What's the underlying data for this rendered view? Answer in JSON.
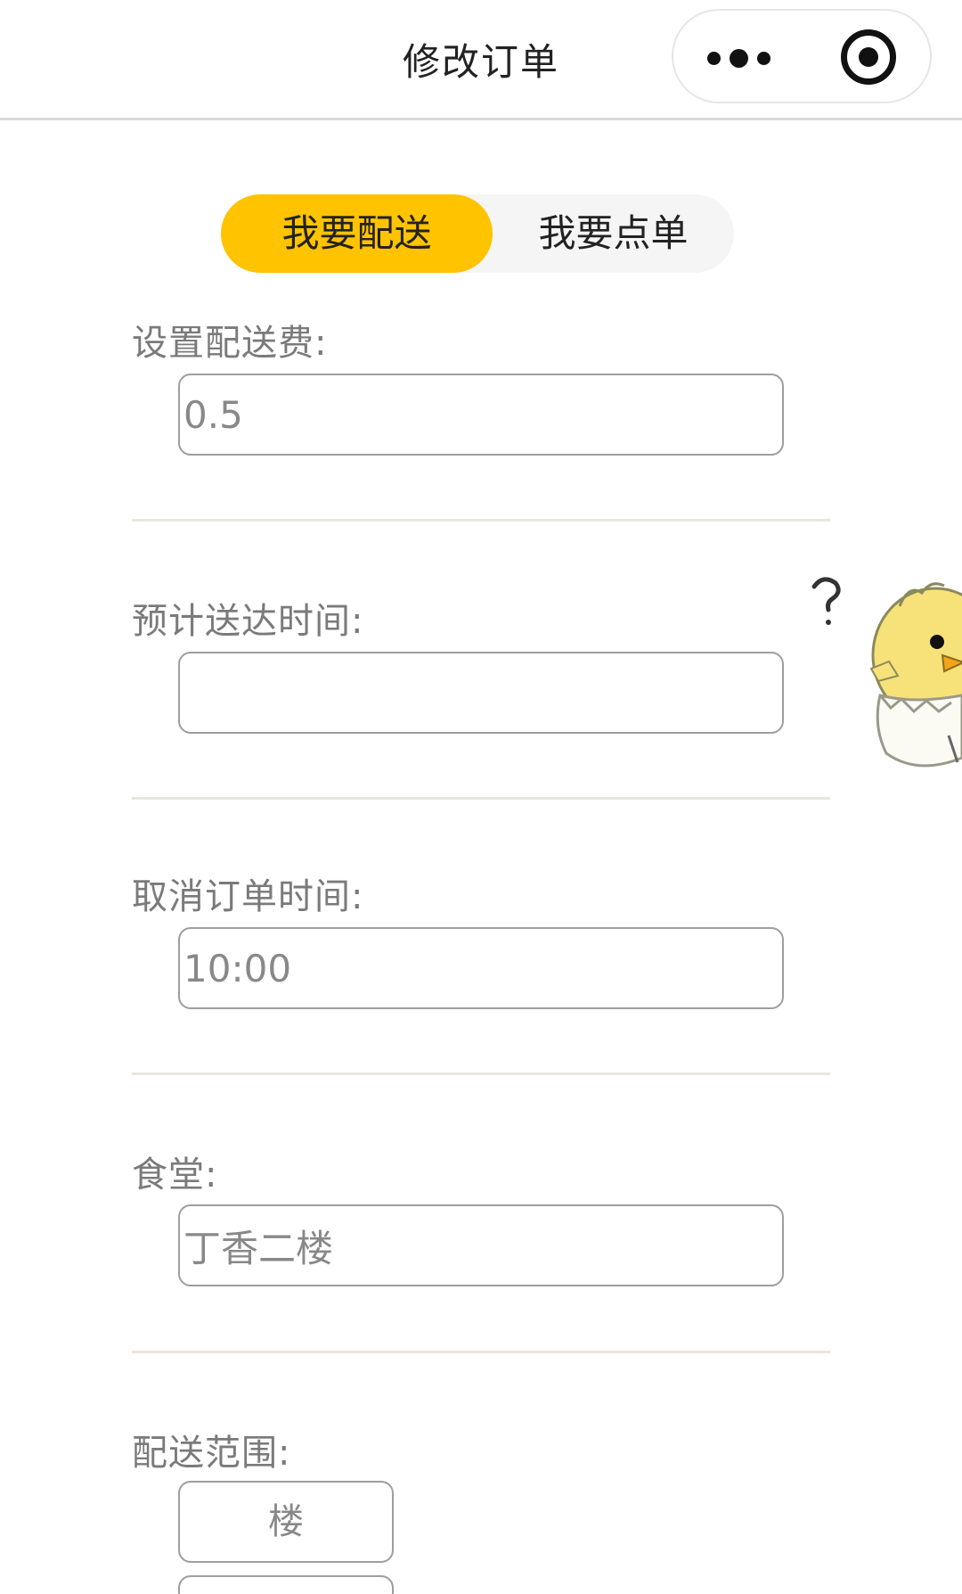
{
  "navbar": {
    "title": "修改订单",
    "capsule": {
      "more_icon": "more-dots-icon",
      "close_icon": "target-circle-icon"
    }
  },
  "tabs": [
    {
      "label": "我要配送",
      "active": true
    },
    {
      "label": "我要点单",
      "active": false
    }
  ],
  "form": {
    "delivery_fee": {
      "label": "设置配送费:",
      "value": "0.5"
    },
    "eta": {
      "label": "预计送达时间:",
      "value": ""
    },
    "cancel_time": {
      "label": "取消订单时间:",
      "value": "10:00"
    },
    "canteen": {
      "label": "食堂:",
      "value": "丁香二楼"
    },
    "range": {
      "label": "配送范围:",
      "first_option": "楼",
      "second_option": ""
    }
  },
  "mascot": {
    "icon": "chick-in-eggshell-icon",
    "accent": "#f7e27a"
  },
  "colors": {
    "accent": "#ffc300",
    "label": "#7a7a7a",
    "border": "#9e9e9e"
  }
}
